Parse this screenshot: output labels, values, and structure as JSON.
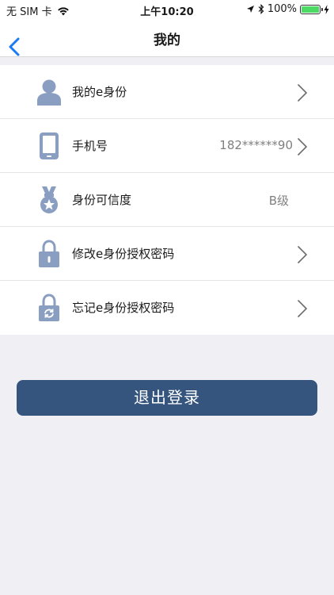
{
  "status_bar": {
    "carrier": "无 SIM 卡",
    "time": "上午10:20",
    "battery_text": "100%",
    "battery_level": 1.0
  },
  "nav": {
    "title": "我的"
  },
  "menu": {
    "items": [
      {
        "label": "我的e身份",
        "value": "",
        "icon": "person-icon",
        "has_arrow": true
      },
      {
        "label": "手机号",
        "value": "182******90",
        "icon": "mobile-phone-icon",
        "has_arrow": true
      },
      {
        "label": "身份可信度",
        "value": "B级",
        "icon": "medal-icon",
        "has_arrow": false
      },
      {
        "label": "修改e身份授权密码",
        "value": "",
        "icon": "lock-icon",
        "has_arrow": true
      },
      {
        "label": "忘记e身份授权密码",
        "value": "",
        "icon": "lock-refresh-icon",
        "has_arrow": true
      }
    ]
  },
  "logout": {
    "label": "退出登录"
  },
  "colors": {
    "accent": "#35557f",
    "icon": "#8a9ec2",
    "background": "#efeff4",
    "back_arrow": "#1a7bf2"
  }
}
